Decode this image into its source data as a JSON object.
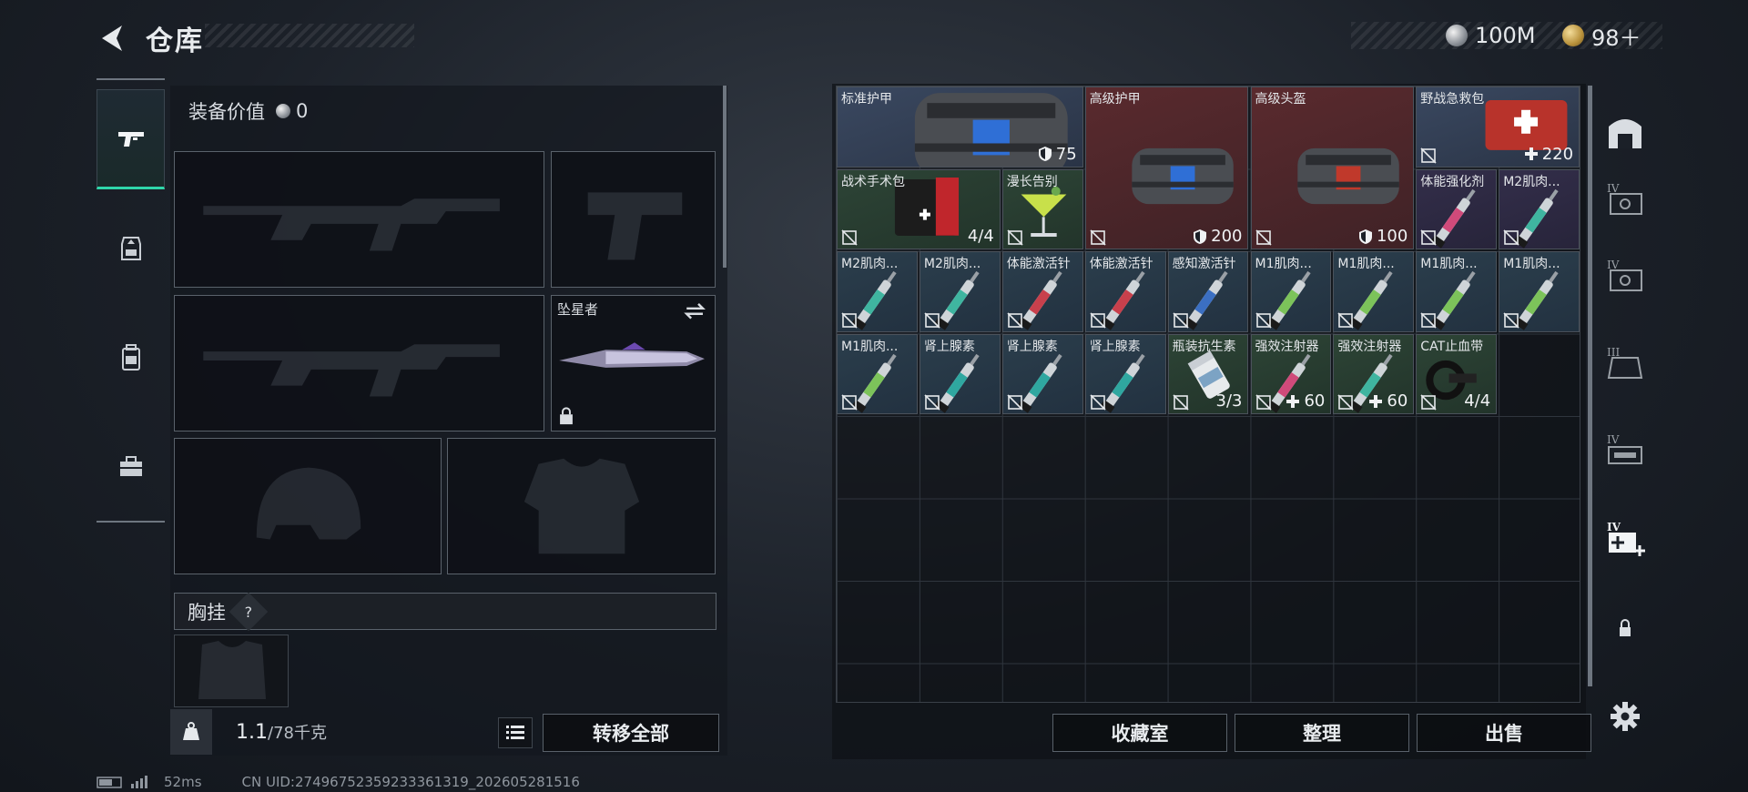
{
  "header": {
    "title": "仓库"
  },
  "currency": {
    "silver": "100M",
    "gold": "98＋"
  },
  "left_tabs": [
    {
      "name": "weapons",
      "icon": "pistol-icon",
      "active": true
    },
    {
      "name": "armor",
      "icon": "armor-rig-icon",
      "active": false
    },
    {
      "name": "backpack",
      "icon": "backpack-icon",
      "active": false
    },
    {
      "name": "supplies",
      "icon": "toolbox-icon",
      "active": false
    }
  ],
  "equipment": {
    "value_label": "装备价值",
    "value": "0",
    "melee_name": "坠星者",
    "chest_label": "胸挂",
    "chest_help": "?"
  },
  "weight": {
    "current": "1.1",
    "capacity": "/78千克",
    "icon_label": "KG"
  },
  "buttons": {
    "transfer_all": "转移全部",
    "collection": "收藏室",
    "organize": "整理",
    "sell": "出售"
  },
  "stash_items": [
    {
      "name": "标准护甲",
      "qty": "75",
      "qty_icon": "shield",
      "color": "blue"
    },
    {
      "name": "高级护甲",
      "qty": "200",
      "qty_icon": "shield",
      "color": "red"
    },
    {
      "name": "高级头盔",
      "qty": "100",
      "qty_icon": "shield",
      "color": "red"
    },
    {
      "name": "野战急救包",
      "qty": "220",
      "qty_icon": "plus",
      "color": "blue"
    },
    {
      "name": "战术手术包",
      "qty": "4/4",
      "qty_icon": "",
      "color": "green"
    },
    {
      "name": "漫长告别",
      "qty": "",
      "qty_icon": "",
      "color": "green"
    },
    {
      "name": "体能强化剂",
      "qty": "",
      "qty_icon": "",
      "color": "purple"
    },
    {
      "name": "M2肌肉...",
      "qty": "",
      "qty_icon": "",
      "color": "purple"
    },
    {
      "name": "M2肌肉...",
      "qty": "",
      "qty_icon": "",
      "color": "teal"
    },
    {
      "name": "M2肌肉...",
      "qty": "",
      "qty_icon": "",
      "color": "teal"
    },
    {
      "name": "体能激活针",
      "qty": "",
      "qty_icon": "",
      "color": "teal"
    },
    {
      "name": "体能激活针",
      "qty": "",
      "qty_icon": "",
      "color": "teal"
    },
    {
      "name": "感知激活针",
      "qty": "",
      "qty_icon": "",
      "color": "teal"
    },
    {
      "name": "M1肌肉...",
      "qty": "",
      "qty_icon": "",
      "color": "teal"
    },
    {
      "name": "M1肌肉...",
      "qty": "",
      "qty_icon": "",
      "color": "teal"
    },
    {
      "name": "M1肌肉...",
      "qty": "",
      "qty_icon": "",
      "color": "teal"
    },
    {
      "name": "M1肌肉...",
      "qty": "",
      "qty_icon": "",
      "color": "teal"
    },
    {
      "name": "M1肌肉...",
      "qty": "",
      "qty_icon": "",
      "color": "teal"
    },
    {
      "name": "肾上腺素",
      "qty": "",
      "qty_icon": "",
      "color": "teal"
    },
    {
      "name": "肾上腺素",
      "qty": "",
      "qty_icon": "",
      "color": "teal"
    },
    {
      "name": "肾上腺素",
      "qty": "",
      "qty_icon": "",
      "color": "teal"
    },
    {
      "name": "瓶装抗生素",
      "qty": "3/3",
      "qty_icon": "",
      "color": "green"
    },
    {
      "name": "强效注射器",
      "qty": "60",
      "qty_icon": "plus",
      "color": "green"
    },
    {
      "name": "强效注射器",
      "qty": "60",
      "qty_icon": "plus",
      "color": "green"
    },
    {
      "name": "CAT止血带",
      "qty": "4/4",
      "qty_icon": "",
      "color": "green"
    }
  ],
  "right_tabs": [
    {
      "icon": "stash-arch-icon"
    },
    {
      "icon": "container-iv-icon",
      "level": "IV"
    },
    {
      "icon": "container-iv-icon",
      "level": "IV"
    },
    {
      "icon": "container-iii-icon",
      "level": "III"
    },
    {
      "icon": "container-iv-icon",
      "level": "IV"
    },
    {
      "icon": "container-add-icon",
      "level": "IV"
    },
    {
      "icon": "lock-icon"
    },
    {
      "icon": "settings-gear-icon"
    }
  ],
  "footer": {
    "ping": "52ms",
    "uid": "CN UID:27496752359233361319_202605281516"
  },
  "colors": {
    "accent": "#2fd6a9",
    "panel": "#14181e",
    "border": "#5a626b"
  }
}
